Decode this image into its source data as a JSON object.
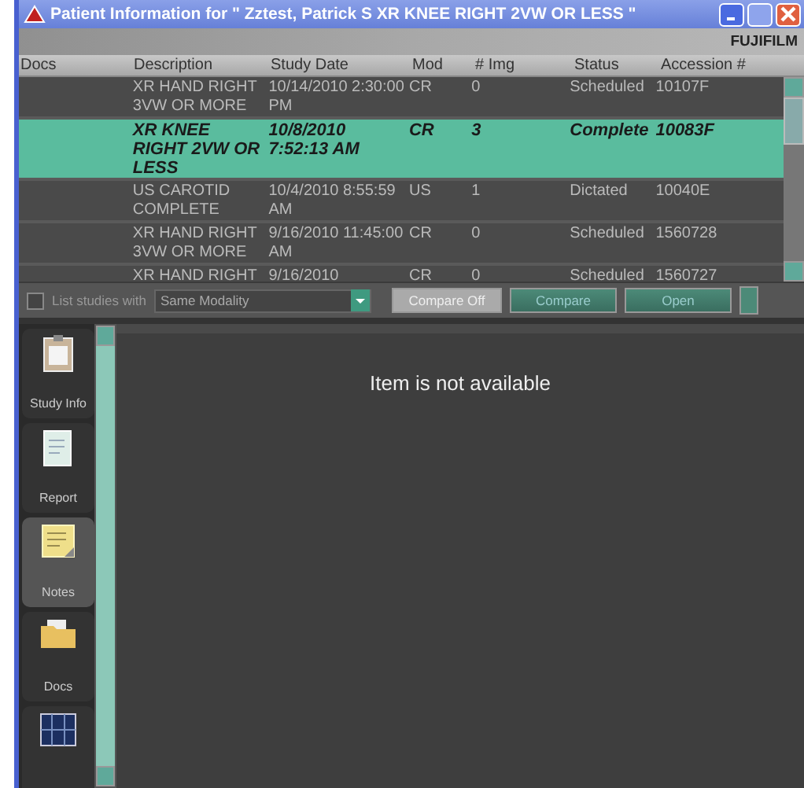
{
  "window": {
    "title": "Patient Information for \" Zztest, Patrick S     XR KNEE RIGHT 2VW OR LESS \"",
    "logo": "FUJIFILM"
  },
  "table": {
    "columns": [
      "Docs",
      "Description",
      "Study Date",
      "Mod",
      "# Img",
      "Status",
      "Accession #"
    ],
    "rows": [
      {
        "selected": false,
        "cells": [
          "",
          "XR HAND RIGHT 3VW OR MORE",
          "10/14/2010 2:30:00 PM",
          "CR",
          "0",
          "Scheduled",
          "10107F"
        ]
      },
      {
        "selected": true,
        "cells": [
          "",
          "XR KNEE RIGHT 2VW OR LESS",
          "10/8/2010 7:52:13 AM",
          "CR",
          "3",
          "Complete",
          "10083F"
        ]
      },
      {
        "selected": false,
        "cells": [
          "",
          "US CAROTID COMPLETE",
          "10/4/2010 8:55:59 AM",
          "US",
          "1",
          "Dictated",
          "10040E"
        ]
      },
      {
        "selected": false,
        "cells": [
          "",
          "XR HAND RIGHT 3VW OR MORE",
          "9/16/2010 11:45:00 AM",
          "CR",
          "0",
          "Scheduled",
          "1560728"
        ]
      },
      {
        "selected": false,
        "cells": [
          "",
          "XR HAND RIGHT",
          "9/16/2010",
          "CR",
          "0",
          "Scheduled",
          "1560727"
        ]
      }
    ]
  },
  "toolbar": {
    "list_studies": {
      "label": "List studies with",
      "checked": false
    },
    "filter": {
      "value": "Same Modality"
    },
    "buttons": [
      {
        "label": "Compare Off",
        "kind": "light"
      },
      {
        "label": "Compare",
        "kind": "teal"
      },
      {
        "label": "Open",
        "kind": "teal"
      }
    ]
  },
  "sidebar": {
    "items": [
      {
        "label": "Study Info",
        "kind": "clipboard",
        "selected": false
      },
      {
        "label": "Report",
        "kind": "report",
        "selected": false
      },
      {
        "label": "Notes",
        "kind": "notes",
        "selected": true
      },
      {
        "label": "Docs",
        "kind": "folder",
        "selected": false
      },
      {
        "kind": "film",
        "selected": false
      }
    ]
  },
  "content": {
    "message": "Item is not available"
  }
}
